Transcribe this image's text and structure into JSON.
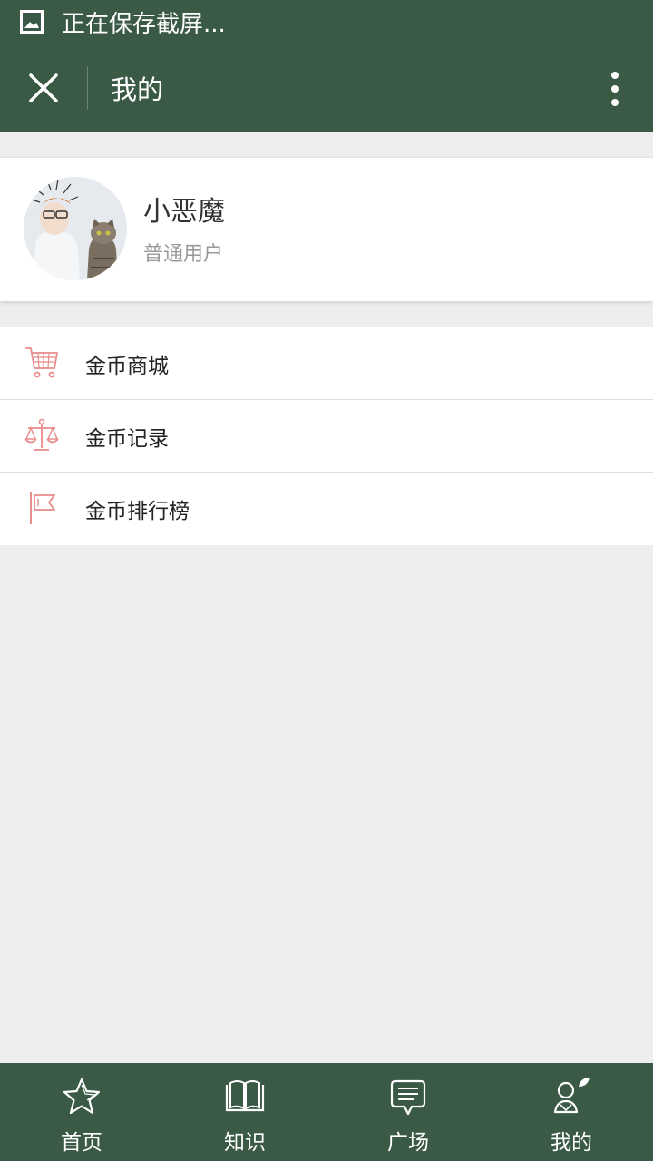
{
  "status_bar": {
    "text": "正在保存截屏..."
  },
  "toolbar": {
    "title": "我的"
  },
  "profile": {
    "name": "小恶魔",
    "role": "普通用户"
  },
  "menu": {
    "items": [
      {
        "label": "金币商城",
        "icon": "cart-icon"
      },
      {
        "label": "金币记录",
        "icon": "scale-icon"
      },
      {
        "label": "金币排行榜",
        "icon": "flag-icon"
      }
    ]
  },
  "tabs": [
    {
      "label": "首页",
      "icon": "star-icon"
    },
    {
      "label": "知识",
      "icon": "book-icon"
    },
    {
      "label": "广场",
      "icon": "chat-icon"
    },
    {
      "label": "我的",
      "icon": "person-leaf-icon"
    }
  ],
  "colors": {
    "primary": "#3a5a46",
    "accent_icon": "#e88b8b",
    "background": "#eeeeee"
  }
}
